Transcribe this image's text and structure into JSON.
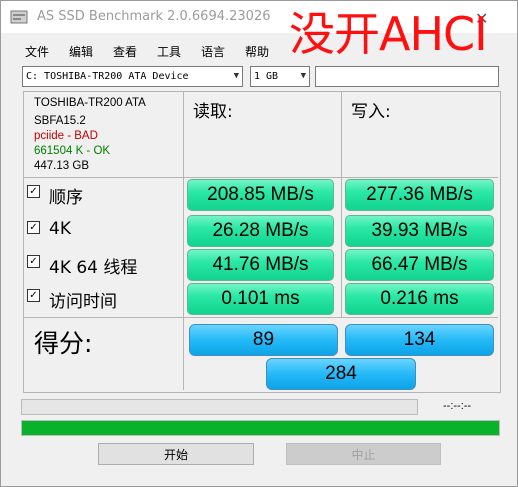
{
  "window": {
    "title": "AS SSD Benchmark 2.0.6694.23026",
    "overlay_text": "没开AHCI"
  },
  "menu": [
    "文件",
    "编辑",
    "查看",
    "工具",
    "语言",
    "帮助"
  ],
  "toolbar": {
    "drive_select": "C: TOSHIBA-TR200 ATA Device",
    "size_select": "1 GB",
    "extra_input": ""
  },
  "device": {
    "name": "TOSHIBA-TR200 ATA",
    "firmware": "SBFA15.2",
    "driver": "pciide - BAD",
    "alignment": "661504 K - OK",
    "capacity": "447.13 GB"
  },
  "columns": {
    "read": "读取:",
    "write": "写入:"
  },
  "rows": [
    {
      "label": "顺序",
      "checked": true,
      "read": "208.85 MB/s",
      "write": "277.36 MB/s"
    },
    {
      "label": "4K",
      "checked": true,
      "read": "26.28 MB/s",
      "write": "39.93 MB/s"
    },
    {
      "label": "4K 64 线程",
      "checked": true,
      "read": "41.76 MB/s",
      "write": "66.47 MB/s"
    },
    {
      "label": "访问时间",
      "checked": true,
      "read": "0.101 ms",
      "write": "0.216 ms"
    }
  ],
  "score": {
    "label": "得分:",
    "read": "89",
    "write": "134",
    "total": "284"
  },
  "status": {
    "time": "--:--:--",
    "progress_fraction": 1.0
  },
  "buttons": {
    "start": "开始",
    "stop": "中止"
  },
  "colors": {
    "result_green": "#2be8a6",
    "score_blue": "#24b9f7",
    "progress_green": "#08b22a",
    "overlay_red": "#ff1010"
  }
}
